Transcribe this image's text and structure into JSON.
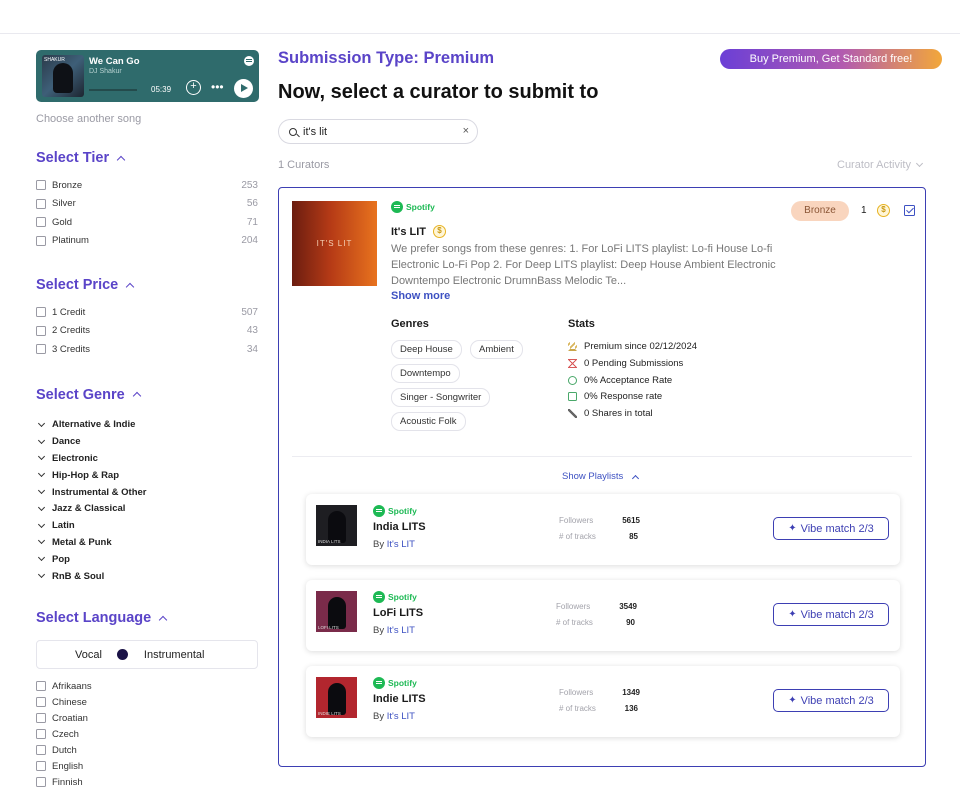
{
  "player": {
    "title": "We Can Go",
    "artist": "DJ Shakur",
    "time": "05:39",
    "art_tag": "SHAKUR"
  },
  "sidebar": {
    "choose_song": "Choose another song",
    "tier": {
      "title": "Select Tier",
      "items": [
        {
          "label": "Bronze",
          "count": "253"
        },
        {
          "label": "Silver",
          "count": "56"
        },
        {
          "label": "Gold",
          "count": "71"
        },
        {
          "label": "Platinum",
          "count": "204"
        }
      ]
    },
    "price": {
      "title": "Select Price",
      "items": [
        {
          "label": "1 Credit",
          "count": "507"
        },
        {
          "label": "2 Credits",
          "count": "43"
        },
        {
          "label": "3 Credits",
          "count": "34"
        }
      ]
    },
    "genre": {
      "title": "Select Genre",
      "items": [
        "Alternative & Indie",
        "Dance",
        "Electronic",
        "Hip-Hop & Rap",
        "Instrumental & Other",
        "Jazz & Classical",
        "Latin",
        "Metal & Punk",
        "Pop",
        "RnB & Soul"
      ]
    },
    "language": {
      "title": "Select Language",
      "vocal": "Vocal",
      "instrumental": "Instrumental",
      "items": [
        "Afrikaans",
        "Chinese",
        "Croatian",
        "Czech",
        "Dutch",
        "English",
        "Finnish"
      ]
    }
  },
  "main": {
    "submission_type": "Submission Type: Premium",
    "promo": "Buy Premium, Get Standard free!",
    "headline": "Now, select a curator to submit to",
    "search_value": "it's lit",
    "curators_count": "1 Curators",
    "sort_label": "Curator Activity"
  },
  "curator": {
    "platform": "Spotify",
    "name": "It's LIT",
    "cover_text": "IT'S LIT",
    "description": "We prefer songs from these genres: 1. For LoFi LITS playlist: Lo-fi House Lo-fi Electronic Lo-Fi Pop 2. For Deep LITS playlist: Deep House Ambient Electronic Downtempo Electronic DrumnBass Melodic Te...",
    "show_more": "Show more",
    "tier": "Bronze",
    "credits": "1",
    "genres_title": "Genres",
    "genres": [
      "Deep House",
      "Ambient",
      "Downtempo",
      "Singer - Songwriter",
      "Acoustic Folk"
    ],
    "stats_title": "Stats",
    "stats": [
      "Premium since 02/12/2024",
      "0 Pending Submissions",
      "0% Acceptance Rate",
      "0% Response rate",
      "0 Shares in total"
    ],
    "show_playlists": "Show Playlists"
  },
  "playlists": [
    {
      "platform": "Spotify",
      "name": "India LITS",
      "by": "By",
      "owner": "It's LIT",
      "followers_label": "Followers",
      "followers": "5615",
      "tracks_label": "# of tracks",
      "tracks": "85",
      "vibe": "Vibe match 2/3",
      "art_label": "INDIA LITS",
      "art_bg": "#1e1e22"
    },
    {
      "platform": "Spotify",
      "name": "LoFi LITS",
      "by": "By",
      "owner": "It's LIT",
      "followers_label": "Followers",
      "followers": "3549",
      "tracks_label": "# of tracks",
      "tracks": "90",
      "vibe": "Vibe match 2/3",
      "art_label": "LOFI LITS",
      "art_bg": "#7a2b4a"
    },
    {
      "platform": "Spotify",
      "name": "Indie LITS",
      "by": "By",
      "owner": "It's LIT",
      "followers_label": "Followers",
      "followers": "1349",
      "tracks_label": "# of tracks",
      "tracks": "136",
      "vibe": "Vibe match 2/3",
      "art_label": "INDIE LITS",
      "art_bg": "#b2262e"
    }
  ],
  "coin_symbol": "$",
  "clear_symbol": "×",
  "colors": {
    "accent": "#5a44c8",
    "link": "#3d51c2",
    "spotify": "#1db954",
    "player_bg": "#2f6b6c"
  }
}
